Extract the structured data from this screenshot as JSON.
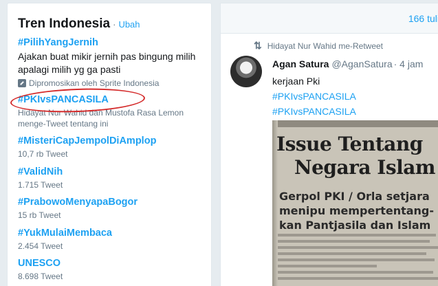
{
  "trends": {
    "title": "Tren Indonesia",
    "separator": "·",
    "change_link": "Ubah",
    "items": [
      {
        "name": "#PilihYangJernih",
        "description": "Ajakan buat mikir jernih pas bingung milih apalagi milih yg ga pasti",
        "promoted": "Dipromosikan oleh Sprite Indonesia"
      },
      {
        "name": "#PKIvsPANCASILA",
        "context": "Hidayat Nur Wahid dan Mustofa Rasa Lemon menge-Tweet tentang ini"
      },
      {
        "name": "#MisteriCapJempolDiAmplop",
        "count": "10,7 rb Tweet"
      },
      {
        "name": "#ValidNih",
        "count": "1.715 Tweet"
      },
      {
        "name": "#PrabowoMenyapaBogor",
        "count": "15 rb Tweet"
      },
      {
        "name": "#YukMulaiMembaca",
        "count": "2.454 Tweet"
      },
      {
        "name": "UNESCO",
        "count": "8.698 Tweet"
      }
    ]
  },
  "timeline": {
    "new_tweets": "166 tuli",
    "retweet_context": "Hidayat Nur Wahid me-Retweet",
    "tweet": {
      "name": "Agan Satura",
      "handle": "@AganSatura",
      "time": "· 4 jam",
      "text": "kerjaan Pki",
      "hashtags": [
        "#PKIvsPANCASILA",
        "#PKIvsPANCASILA"
      ],
      "image": {
        "headline_1": "Issue Tentang",
        "headline_2": "Negara Islam",
        "sub_1": "Gerpol PKI / Orla setjara",
        "sub_2": "menipu mempertentang-",
        "sub_3": "kan Pantjasila dan Islam"
      }
    }
  },
  "colors": {
    "link": "#1da1f2",
    "annotation": "#d42a2a"
  },
  "icons": {
    "promo": "promoted-icon",
    "retweet": "retweet-icon"
  }
}
